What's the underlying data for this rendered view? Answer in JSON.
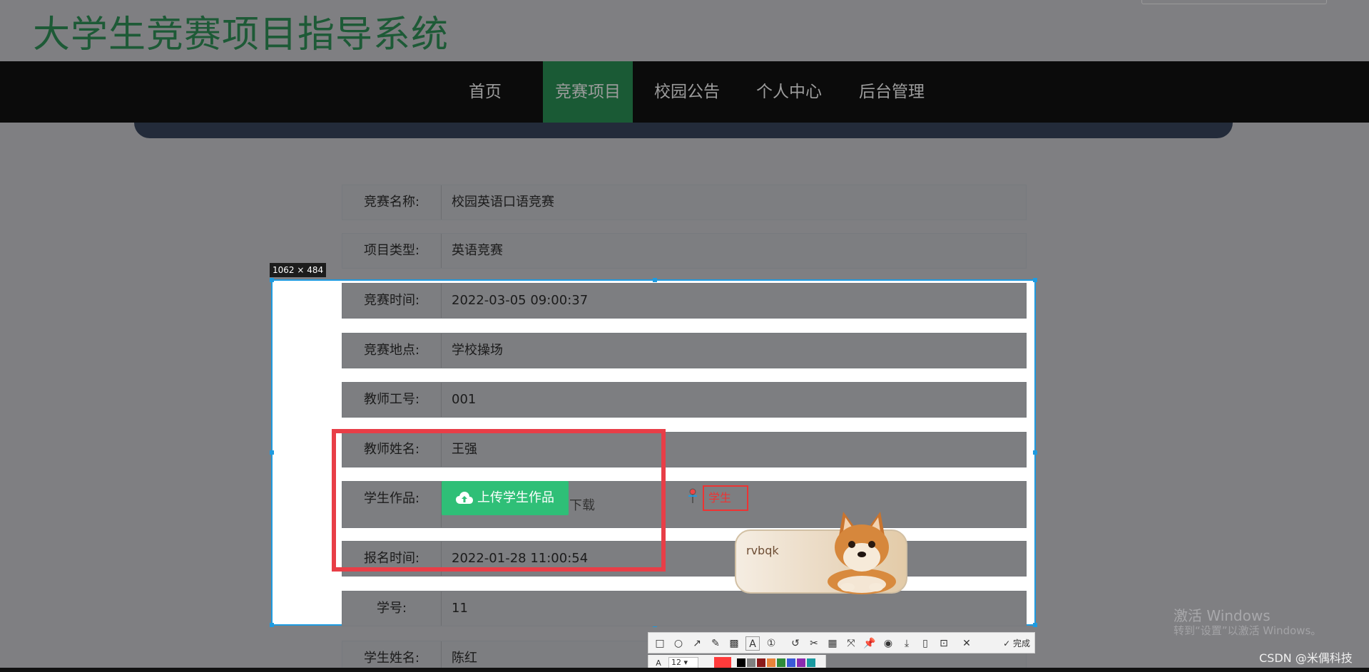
{
  "site": {
    "title": "大学生竞赛项目指导系统"
  },
  "nav": {
    "items": [
      {
        "label": "首页"
      },
      {
        "label": "竞赛项目"
      },
      {
        "label": "校园公告"
      },
      {
        "label": "个人中心"
      },
      {
        "label": "后台管理"
      }
    ],
    "active": "竞赛项目"
  },
  "form": {
    "rows": [
      {
        "label": "竞赛名称:",
        "value": "校园英语口语竞赛"
      },
      {
        "label": "项目类型:",
        "value": "英语竞赛"
      },
      {
        "label": "竞赛时间:",
        "value": "2022-03-05 09:00:37"
      },
      {
        "label": "竞赛地点:",
        "value": "学校操场"
      },
      {
        "label": "教师工号:",
        "value": "001"
      },
      {
        "label": "教师姓名:",
        "value": "王强"
      },
      {
        "label": "学生作品:",
        "value": ""
      },
      {
        "label": "报名时间:",
        "value": "2022-01-28 11:00:54"
      },
      {
        "label": "学号:",
        "value": "11"
      },
      {
        "label": "学生姓名:",
        "value": "陈红"
      }
    ],
    "upload_button": "上传学生作品",
    "download_link": "下载"
  },
  "screenshot_tool": {
    "dimensions": "1062 × 484",
    "text_annotation": "学生",
    "sticker_text": "rvbqk",
    "toolbar_done": "完成",
    "font_size": "12",
    "tools": [
      "rectangle-icon",
      "ellipse-icon",
      "arrow-icon",
      "pencil-icon",
      "mosaic-icon",
      "text-icon",
      "number-icon",
      "undo-icon",
      "cut-icon",
      "ocr-icon",
      "expand-icon",
      "pin-icon",
      "save-icon",
      "phone-icon",
      "bookmark-icon",
      "close-icon",
      "check-icon"
    ],
    "colors": [
      "#ff3b3b",
      "#000000",
      "#808080",
      "#8b1a1a",
      "#e8833a",
      "#2e8b3a",
      "#3a5ad8",
      "#8a2bb0",
      "#1a9aa0"
    ],
    "accent_color": "#1e9be0",
    "highlight_color": "#e83e47"
  },
  "os": {
    "activation_title": "激活 Windows",
    "activation_sub": "转到“设置”以激活 Windows。",
    "watermark": "CSDN @米偶科技"
  },
  "theme": {
    "brand_green": "#1a5a35",
    "button_green": "#2fbf77"
  }
}
